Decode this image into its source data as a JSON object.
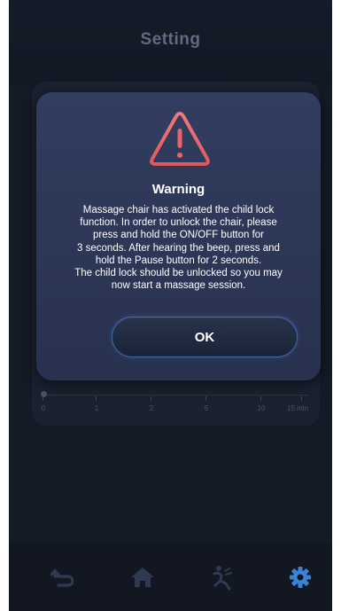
{
  "header": {
    "title": "Setting"
  },
  "timer_scale": {
    "ticks": [
      "0",
      "1",
      "2",
      "5",
      "10",
      "15 min"
    ]
  },
  "dialog": {
    "icon": "warning-triangle-icon",
    "title": "Warning",
    "message": "Massage chair has activated the child lock\nfunction. In order to unlock the chair, please\npress and hold the ON/OFF button for\n3 seconds. After hearing the beep, press and\nhold the Pause button for 2 seconds.\nThe child lock should be unlocked so you may\nnow start a massage session.",
    "ok_label": "OK"
  },
  "footer": {
    "items": [
      {
        "icon": "back-arrow-icon"
      },
      {
        "icon": "home-icon"
      },
      {
        "icon": "massage-figure-icon"
      },
      {
        "icon": "gear-icon"
      }
    ]
  },
  "colors": {
    "background": "#141a26",
    "dialog": "#2e3858",
    "warning_red": "#e86468",
    "ok_border": "#3c6aa8",
    "active_nav": "#3b82d6"
  }
}
